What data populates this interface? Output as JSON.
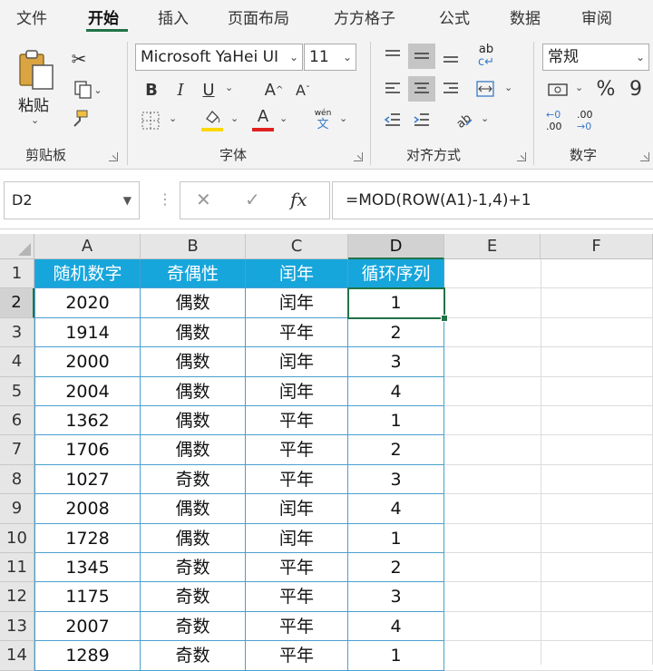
{
  "tabs": [
    "文件",
    "开始",
    "插入",
    "页面布局",
    "方方格子",
    "公式",
    "数据",
    "审阅"
  ],
  "clipboard": {
    "paste_label": "粘贴",
    "group_label": "剪贴板"
  },
  "font": {
    "name": "Microsoft YaHei UI",
    "size": "11",
    "bold": "B",
    "italic": "I",
    "underline": "U",
    "grow": "A",
    "shrink": "A",
    "font_color_letter": "A",
    "pinyin_top": "wén",
    "pinyin_bottom": "文",
    "group_label": "字体",
    "fill_color": "#ffd800",
    "font_color": "#e02020"
  },
  "alignment": {
    "wrap_top": "ab",
    "wrap_bottom": "c",
    "group_label": "对齐方式"
  },
  "number": {
    "format": "常规",
    "percent": "%",
    "comma": "9",
    "inc_top": "←0",
    "inc_bottom": ".00",
    "dec_top": ".00",
    "dec_bottom": "→0",
    "group_label": "数字"
  },
  "formula_bar": {
    "name_box": "D2",
    "cancel": "✕",
    "enter": "✓",
    "fx": "fx",
    "formula": "=MOD(ROW(A1)-1,4)+1"
  },
  "sheet": {
    "columns": [
      "A",
      "B",
      "C",
      "D",
      "E",
      "F"
    ],
    "selected_column": "D",
    "selected_row": "2",
    "header_fill": "#17a6dc",
    "border_color": "#4a9fd0",
    "headers": [
      "随机数字",
      "奇偶性",
      "闰年",
      "循环序列"
    ],
    "rows": [
      {
        "row": "2",
        "a": "2020",
        "b": "偶数",
        "c": "闰年",
        "d": "1"
      },
      {
        "row": "3",
        "a": "1914",
        "b": "偶数",
        "c": "平年",
        "d": "2"
      },
      {
        "row": "4",
        "a": "2000",
        "b": "偶数",
        "c": "闰年",
        "d": "3"
      },
      {
        "row": "5",
        "a": "2004",
        "b": "偶数",
        "c": "闰年",
        "d": "4"
      },
      {
        "row": "6",
        "a": "1362",
        "b": "偶数",
        "c": "平年",
        "d": "1"
      },
      {
        "row": "7",
        "a": "1706",
        "b": "偶数",
        "c": "平年",
        "d": "2"
      },
      {
        "row": "8",
        "a": "1027",
        "b": "奇数",
        "c": "平年",
        "d": "3"
      },
      {
        "row": "9",
        "a": "2008",
        "b": "偶数",
        "c": "闰年",
        "d": "4"
      },
      {
        "row": "10",
        "a": "1728",
        "b": "偶数",
        "c": "闰年",
        "d": "1"
      },
      {
        "row": "11",
        "a": "1345",
        "b": "奇数",
        "c": "平年",
        "d": "2"
      },
      {
        "row": "12",
        "a": "1175",
        "b": "奇数",
        "c": "平年",
        "d": "3"
      },
      {
        "row": "13",
        "a": "2007",
        "b": "奇数",
        "c": "平年",
        "d": "4"
      },
      {
        "row": "14",
        "a": "1289",
        "b": "奇数",
        "c": "平年",
        "d": "1"
      }
    ],
    "header_row": "1"
  }
}
